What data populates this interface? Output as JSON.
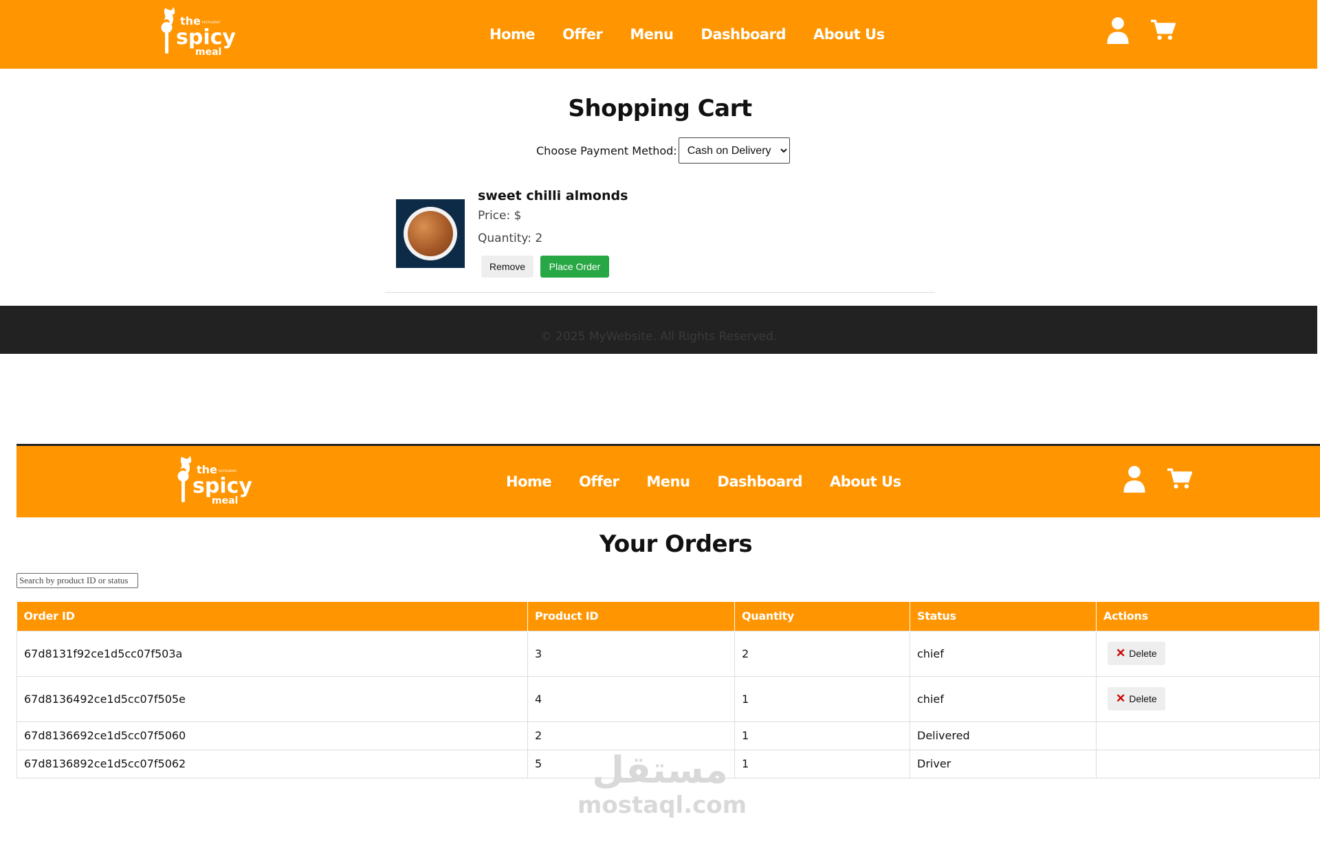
{
  "brand": {
    "logo_top": "the",
    "logo_main": "spicy",
    "logo_bottom": "meal",
    "logo_tag": "RESTAURANT"
  },
  "nav": [
    "Home",
    "Offer",
    "Menu",
    "Dashboard",
    "About Us"
  ],
  "icons": {
    "user": "user-icon",
    "cart": "cart-icon",
    "delete": "close-x-icon"
  },
  "colors": {
    "brand_orange": "#ff9500",
    "place_order_green": "#28a745",
    "footer_dark": "#222222",
    "delete_red": "#cc0000"
  },
  "cart": {
    "title": "Shopping Cart",
    "payment_label": "Choose Payment Method:",
    "payment_selected": "Cash on Delivery",
    "item": {
      "name": "sweet chilli almonds",
      "price": "Price: $",
      "quantity": "Quantity: 2",
      "remove_label": "Remove",
      "place_order_label": "Place Order"
    }
  },
  "footer": {
    "text": "© 2025 MyWebsite. All Rights Reserved."
  },
  "orders": {
    "title": "Your Orders",
    "search_placeholder": "Search by product ID or status",
    "columns": [
      "Order ID",
      "Product ID",
      "Quantity",
      "Status",
      "Actions"
    ],
    "rows": [
      {
        "order_id": "67d8131f92ce1d5cc07f503a",
        "product_id": "3",
        "quantity": "2",
        "status": "chief",
        "action": "Delete"
      },
      {
        "order_id": "67d8136492ce1d5cc07f505e",
        "product_id": "4",
        "quantity": "1",
        "status": "chief",
        "action": "Delete"
      },
      {
        "order_id": "67d8136692ce1d5cc07f5060",
        "product_id": "2",
        "quantity": "1",
        "status": "Delivered",
        "action": ""
      },
      {
        "order_id": "67d8136892ce1d5cc07f5062",
        "product_id": "5",
        "quantity": "1",
        "status": "Driver",
        "action": ""
      }
    ]
  },
  "watermark": {
    "arabic": "مستقل",
    "latin": "mostaql.com"
  }
}
